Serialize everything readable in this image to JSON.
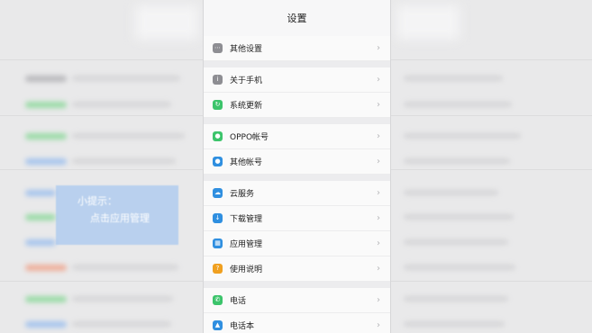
{
  "screen": {
    "title": "设置"
  },
  "groups": [
    {
      "items": [
        {
          "label": "其他设置",
          "icon": "more-icon",
          "color": "#8e8e93"
        }
      ]
    },
    {
      "items": [
        {
          "label": "关于手机",
          "icon": "info-icon",
          "color": "#8e8e93"
        },
        {
          "label": "系统更新",
          "icon": "update-icon",
          "color": "#3cc46b"
        }
      ]
    },
    {
      "items": [
        {
          "label": "OPPO帐号",
          "icon": "user-icon",
          "color": "#3cc46b"
        },
        {
          "label": "其他帐号",
          "icon": "account-icon",
          "color": "#2f8fe0"
        }
      ]
    },
    {
      "items": [
        {
          "label": "云服务",
          "icon": "cloud-icon",
          "color": "#2f8fe0"
        },
        {
          "label": "下载管理",
          "icon": "download-icon",
          "color": "#2f8fe0"
        },
        {
          "label": "应用管理",
          "icon": "apps-icon",
          "color": "#2f8fe0"
        },
        {
          "label": "使用说明",
          "icon": "help-icon",
          "color": "#f0a020"
        }
      ]
    },
    {
      "items": [
        {
          "label": "电话",
          "icon": "phone-icon",
          "color": "#3cc46b"
        },
        {
          "label": "电话本",
          "icon": "contacts-icon",
          "color": "#2f8fe0"
        }
      ]
    }
  ],
  "hint": {
    "title": "小提示：",
    "text": "点击应用管理"
  }
}
